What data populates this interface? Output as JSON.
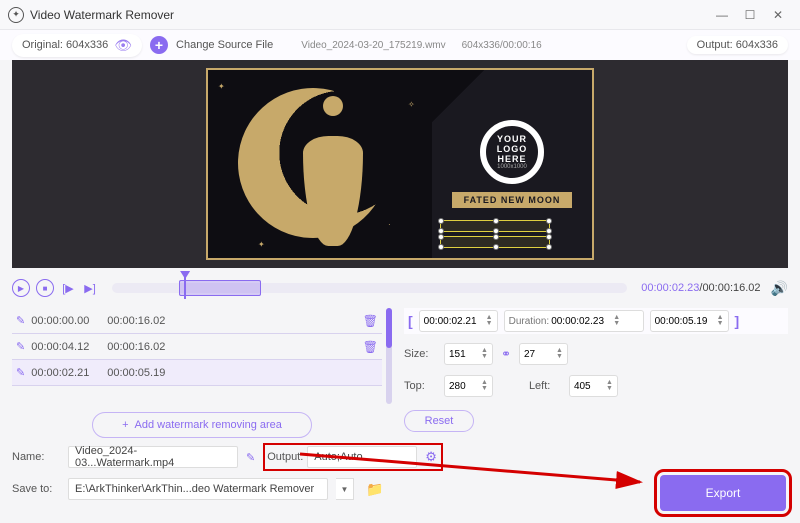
{
  "titlebar": {
    "title": "Video Watermark Remover"
  },
  "toolbar": {
    "original_label": "Original: 604x336",
    "change_source": "Change Source File",
    "file_name": "Video_2024-03-20_175219.wmv",
    "file_meta": "604x336/00:00:16",
    "output_label": "Output: 604x336"
  },
  "preview": {
    "logo_l1a": "YOUR",
    "logo_l1b": "LOGO",
    "logo_l1c": "HERE",
    "logo_l2": "1000x1000",
    "banner": "FATED NEW MOON"
  },
  "playback": {
    "time_current": "00:00:02.23",
    "time_sep": "/",
    "time_total": "00:00:16.02"
  },
  "areas": [
    {
      "start": "00:00:00.00",
      "end": "00:00:16.02"
    },
    {
      "start": "00:00:04.12",
      "end": "00:00:16.02"
    },
    {
      "start": "00:00:02.21",
      "end": "00:00:05.19"
    }
  ],
  "add_area_label": "Add watermark removing area",
  "range": {
    "start": "00:00:02.21",
    "duration_label": "Duration:",
    "duration": "00:00:02.23",
    "end": "00:00:05.19"
  },
  "size": {
    "label": "Size:",
    "w": "151",
    "h": "27",
    "top_label": "Top:",
    "top": "280",
    "left_label": "Left:",
    "left": "405"
  },
  "reset_label": "Reset",
  "bottom": {
    "name_label": "Name:",
    "name_value": "Video_2024-03...Watermark.mp4",
    "output_label": "Output:",
    "output_value": "Auto;Auto",
    "save_label": "Save to:",
    "save_value": "E:\\ArkThinker\\ArkThin...deo Watermark Remover"
  },
  "export_label": "Export"
}
